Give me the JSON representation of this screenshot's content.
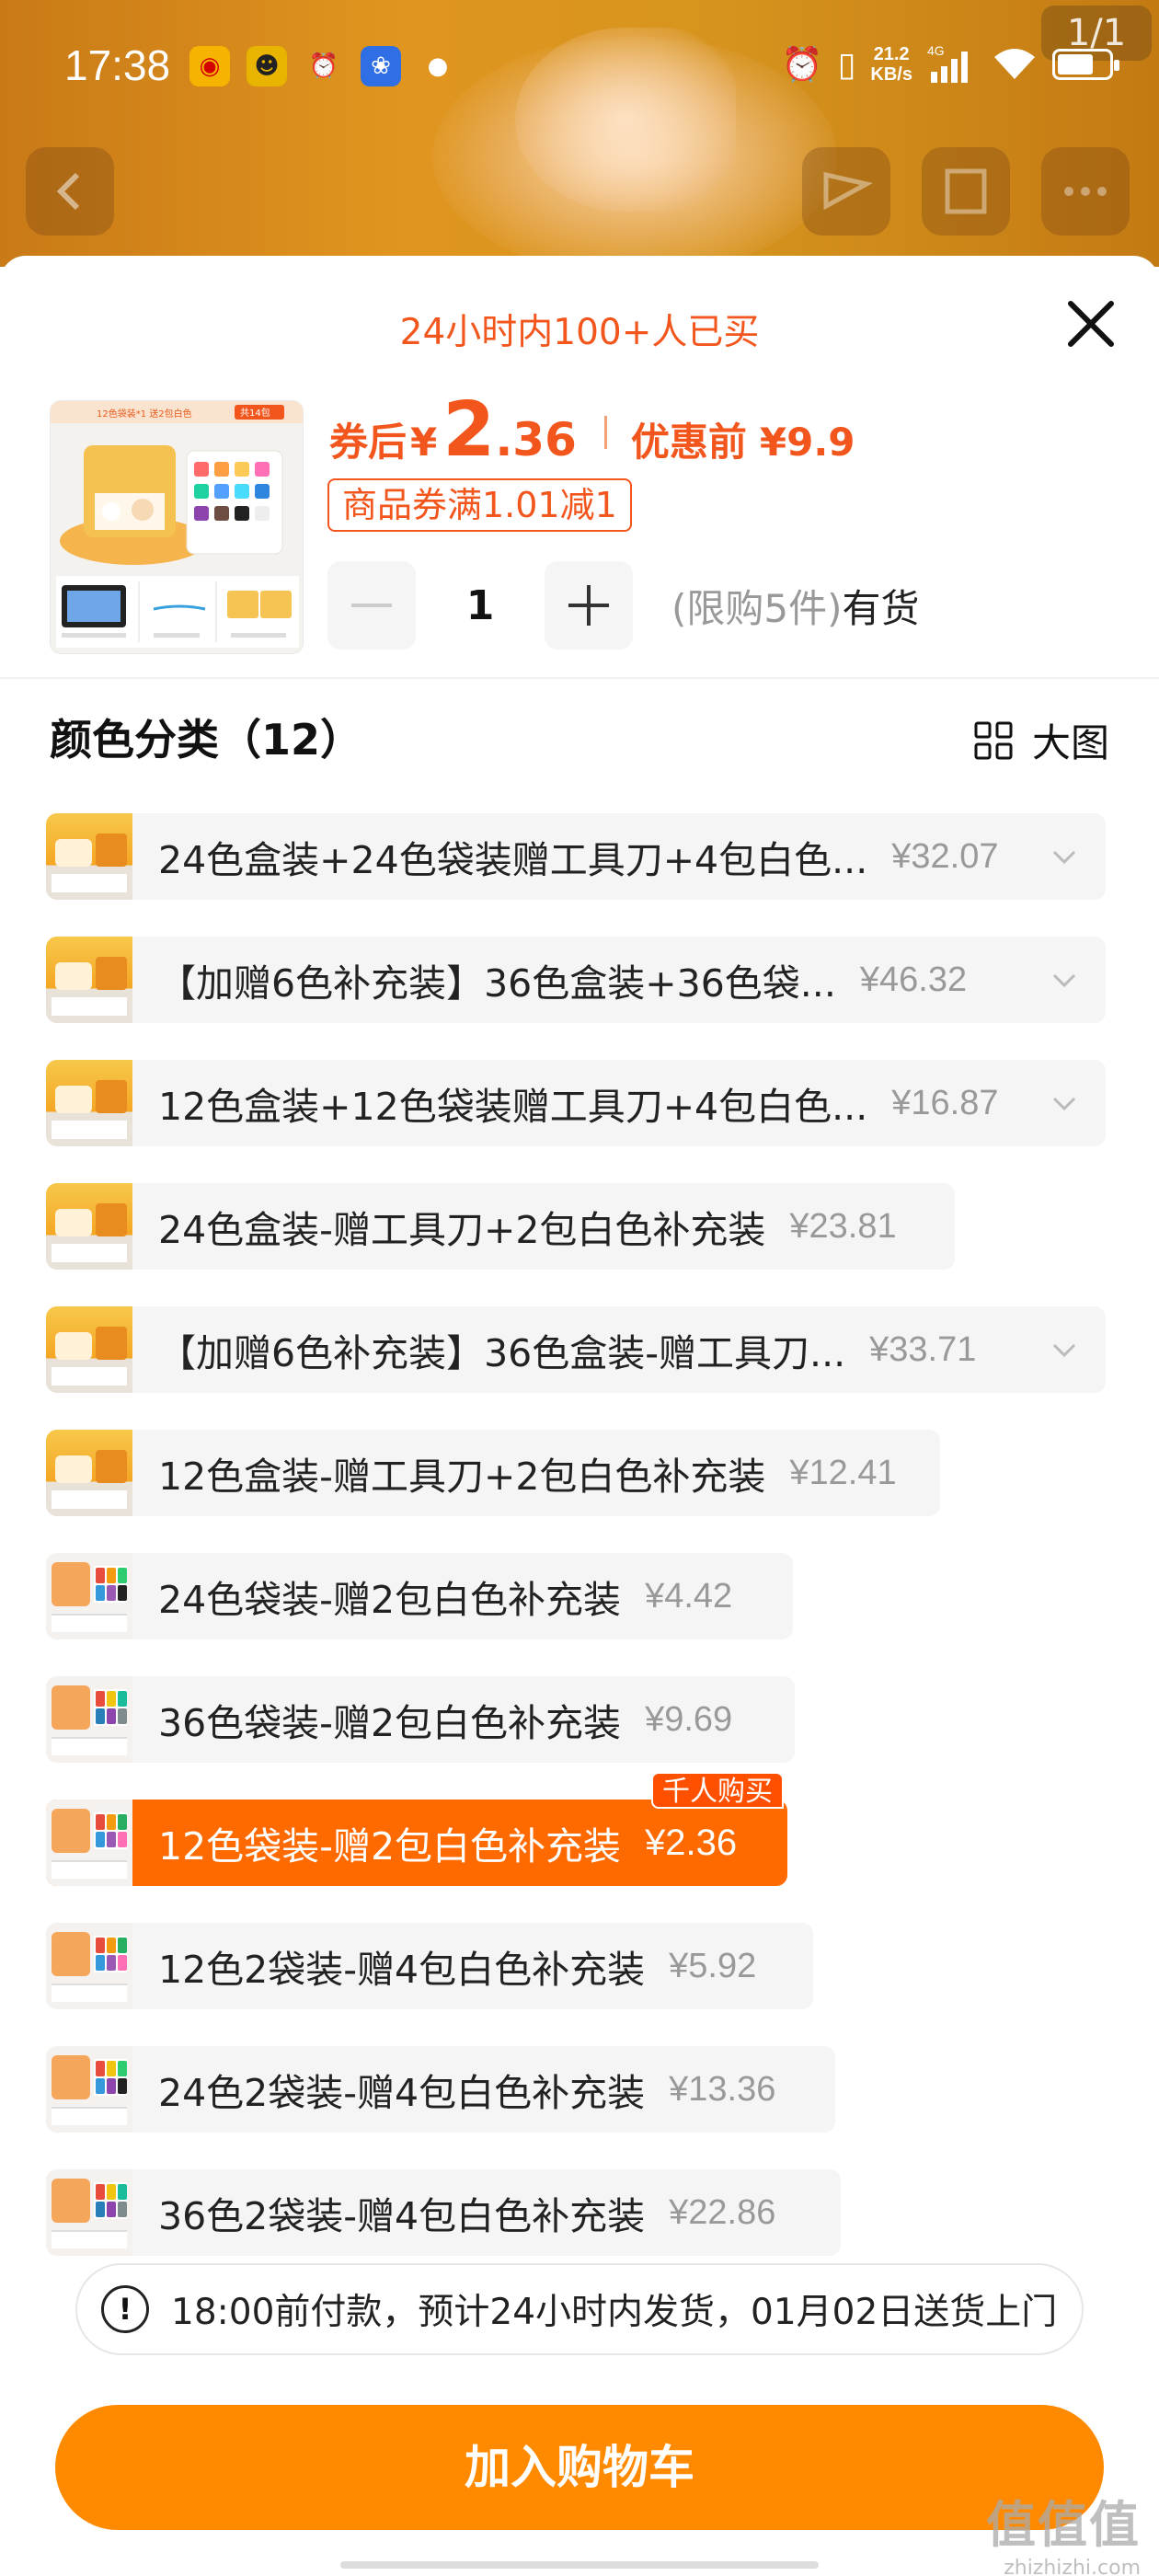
{
  "status_bar": {
    "time": "17:38",
    "network_speed_top": "21.2",
    "network_speed_bottom": "KB/s",
    "network_type": "4G",
    "battery_level": 0.7
  },
  "gallery_counter": "1/1",
  "sheet": {
    "bought_text": "24小时内100+人已买",
    "price": {
      "after_label": "券后",
      "currency": "¥",
      "integer": "2",
      "decimal": ".36",
      "before_label": "优惠前",
      "before_value": "¥9.9"
    },
    "coupon": "商品券满1.01减1",
    "quantity": "1",
    "limit_text": "(限购5件)",
    "stock_text": "有货",
    "section_title": "颜色分类（12）",
    "big_view_label": "大图",
    "product_thumb_banner": "12色袋装*1 送2包白色",
    "product_thumb_count": "共14包"
  },
  "options": [
    {
      "name": "24色盒装+24色袋装赠工具刀+4包白色...",
      "price": "¥32.07",
      "expandable": true
    },
    {
      "name": "【加赠6色补充装】36色盒装+36色袋...",
      "price": "¥46.32",
      "expandable": true
    },
    {
      "name": "12色盒装+12色袋装赠工具刀+4包白色...",
      "price": "¥16.87",
      "expandable": true
    },
    {
      "name": "24色盒装-赠工具刀+2包白色补充装",
      "price": "¥23.81",
      "expandable": false
    },
    {
      "name": "【加赠6色补充装】36色盒装-赠工具刀...",
      "price": "¥33.71",
      "expandable": true
    },
    {
      "name": "12色盒装-赠工具刀+2包白色补充装",
      "price": "¥12.41",
      "expandable": false
    },
    {
      "name": "24色袋装-赠2包白色补充装",
      "price": "¥4.42",
      "expandable": false
    },
    {
      "name": "36色袋装-赠2包白色补充装",
      "price": "¥9.69",
      "expandable": false
    },
    {
      "name": "12色袋装-赠2包白色补充装",
      "price": "¥2.36",
      "expandable": false,
      "selected": true,
      "badge": "千人购买"
    },
    {
      "name": "12色2袋装-赠4包白色补充装",
      "price": "¥5.92",
      "expandable": false
    },
    {
      "name": "24色2袋装-赠4包白色补充装",
      "price": "¥13.36",
      "expandable": false
    },
    {
      "name": "36色2袋装-赠4包白色补充装",
      "price": "¥22.86",
      "expandable": false
    }
  ],
  "delivery_notice": "18:00前付款，预计24小时内发货，01月02日送货上门",
  "add_to_cart": "加入购物车",
  "watermark": {
    "logo": "值值值",
    "url": "zhizhizhi.com"
  },
  "colors": {
    "accent": "#f2561d",
    "selected_bg": "#ff6a00",
    "cart_button": "#ff8a00"
  }
}
